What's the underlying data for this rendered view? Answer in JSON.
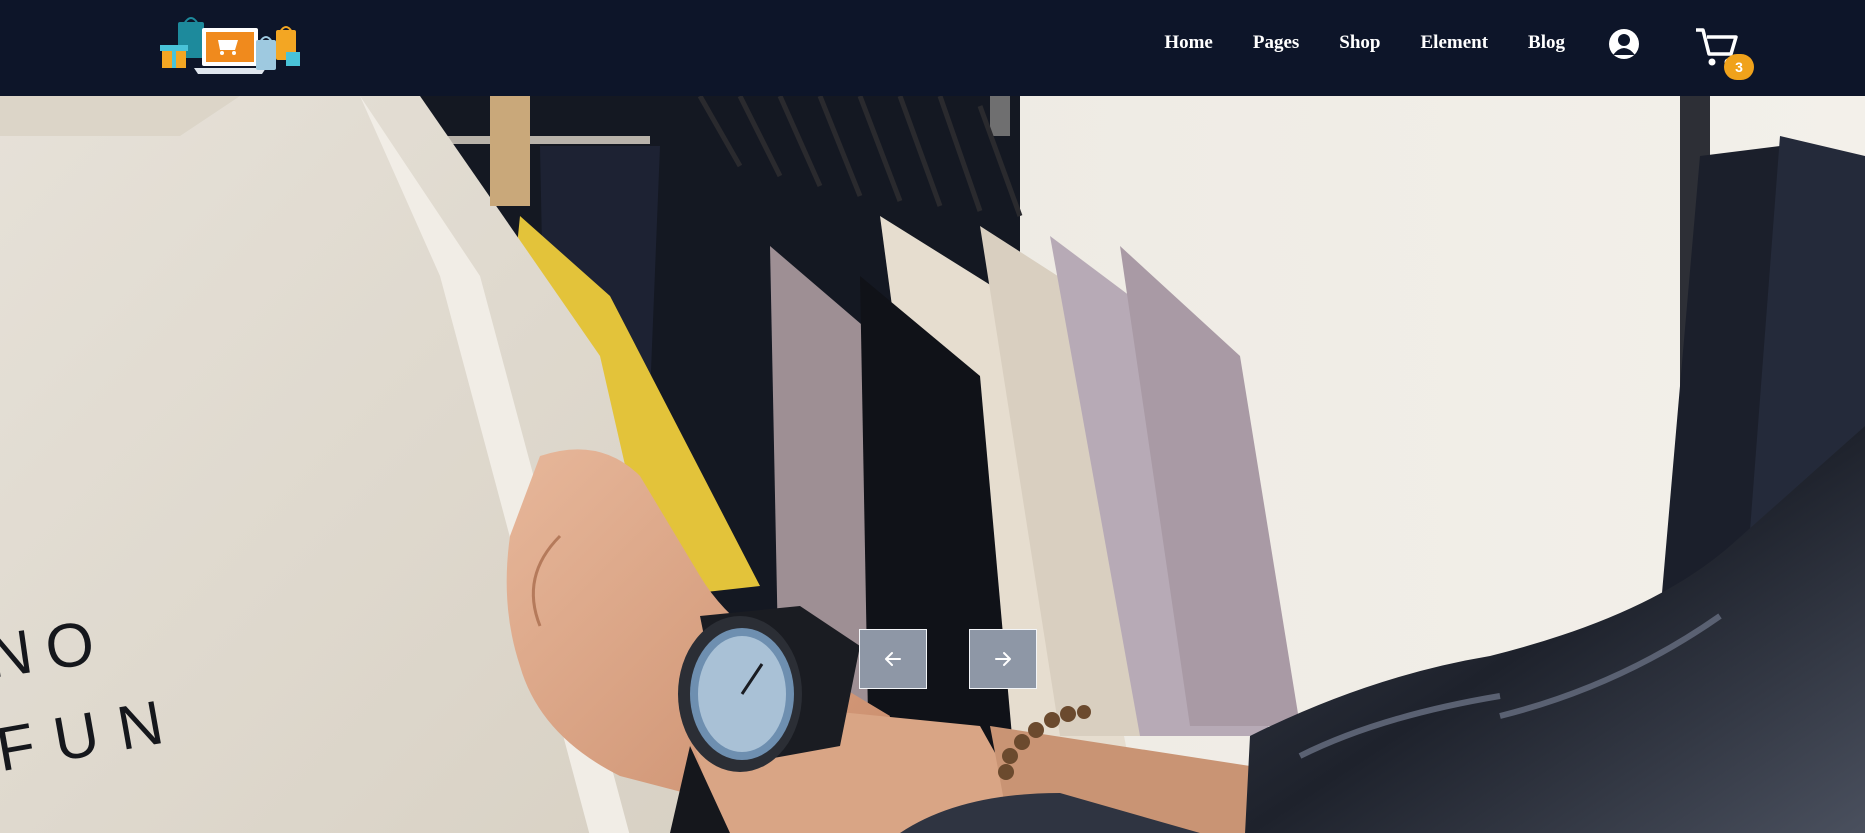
{
  "nav": {
    "links": [
      {
        "label": "Home"
      },
      {
        "label": "Pages"
      },
      {
        "label": "Shop"
      },
      {
        "label": "Element"
      },
      {
        "label": "Blog"
      }
    ],
    "user_icon": "user-circle-icon",
    "cart_icon": "shopping-cart-icon",
    "cart_count": "3"
  },
  "hero": {
    "shirt_print": [
      "NO",
      "FUN"
    ],
    "prev_icon": "arrow-left-icon",
    "next_icon": "arrow-right-icon"
  },
  "colors": {
    "navbar_bg": "#0d1529",
    "badge": "#f0a21b",
    "slider_button": "#8e97a6"
  }
}
